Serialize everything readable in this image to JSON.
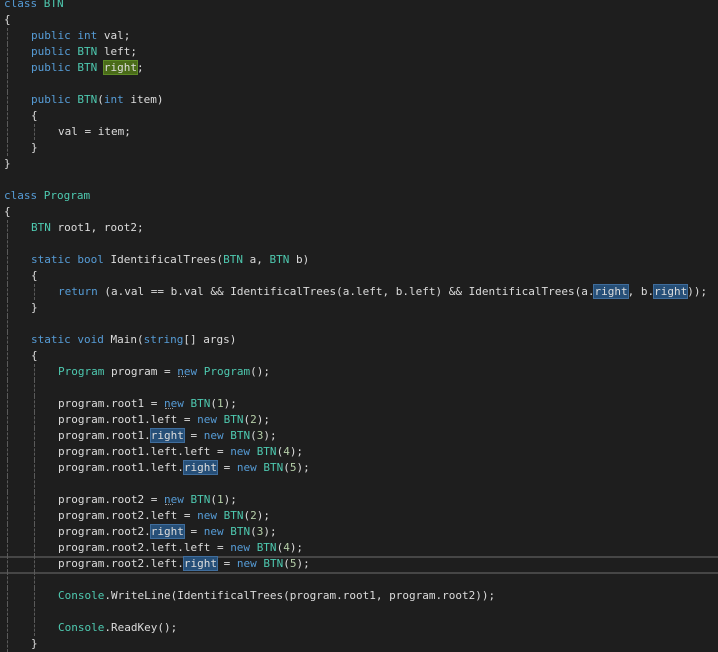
{
  "editor": {
    "language": "C#",
    "current_line": 36,
    "lines": [
      {
        "n": 1,
        "indent": 0,
        "tokens": [
          [
            "kw",
            "class"
          ],
          [
            "id",
            " "
          ],
          [
            "ty",
            "BTN"
          ]
        ]
      },
      {
        "n": 2,
        "indent": 0,
        "tokens": [
          [
            "id",
            "{"
          ]
        ]
      },
      {
        "n": 3,
        "indent": 1,
        "tokens": [
          [
            "kw",
            "public"
          ],
          [
            "id",
            " "
          ],
          [
            "kw",
            "int"
          ],
          [
            "id",
            " val;"
          ]
        ]
      },
      {
        "n": 4,
        "indent": 1,
        "tokens": [
          [
            "kw",
            "public"
          ],
          [
            "id",
            " "
          ],
          [
            "ty",
            "BTN"
          ],
          [
            "id",
            " left;"
          ]
        ]
      },
      {
        "n": 5,
        "indent": 1,
        "tokens": [
          [
            "kw",
            "public"
          ],
          [
            "id",
            " "
          ],
          [
            "ty",
            "BTN"
          ],
          [
            "id",
            " "
          ],
          [
            "hl-green",
            "right"
          ],
          [
            "id",
            ";"
          ]
        ]
      },
      {
        "n": 6,
        "indent": 0,
        "tokens": []
      },
      {
        "n": 7,
        "indent": 1,
        "tokens": [
          [
            "kw",
            "public"
          ],
          [
            "id",
            " "
          ],
          [
            "ty",
            "BTN"
          ],
          [
            "id",
            "("
          ],
          [
            "kw",
            "int"
          ],
          [
            "id",
            " item)"
          ]
        ]
      },
      {
        "n": 8,
        "indent": 1,
        "tokens": [
          [
            "id",
            "{"
          ]
        ]
      },
      {
        "n": 9,
        "indent": 2,
        "tokens": [
          [
            "id",
            "val = item;"
          ]
        ]
      },
      {
        "n": 10,
        "indent": 1,
        "tokens": [
          [
            "id",
            "}"
          ]
        ]
      },
      {
        "n": 11,
        "indent": 0,
        "tokens": [
          [
            "id",
            "}"
          ]
        ]
      },
      {
        "n": 12,
        "indent": 0,
        "tokens": []
      },
      {
        "n": 13,
        "indent": 0,
        "tokens": [
          [
            "kw",
            "class"
          ],
          [
            "id",
            " "
          ],
          [
            "ty",
            "Program"
          ]
        ]
      },
      {
        "n": 14,
        "indent": 0,
        "tokens": [
          [
            "id",
            "{"
          ]
        ]
      },
      {
        "n": 15,
        "indent": 1,
        "tokens": [
          [
            "ty",
            "BTN"
          ],
          [
            "id",
            " root1, root2;"
          ]
        ]
      },
      {
        "n": 16,
        "indent": 0,
        "tokens": []
      },
      {
        "n": 17,
        "indent": 1,
        "tokens": [
          [
            "kw",
            "static"
          ],
          [
            "id",
            " "
          ],
          [
            "kw",
            "bool"
          ],
          [
            "id",
            " IdentificalTrees("
          ],
          [
            "ty",
            "BTN"
          ],
          [
            "id",
            " a, "
          ],
          [
            "ty",
            "BTN"
          ],
          [
            "id",
            " b)"
          ]
        ]
      },
      {
        "n": 18,
        "indent": 1,
        "tokens": [
          [
            "id",
            "{"
          ]
        ]
      },
      {
        "n": 19,
        "indent": 2,
        "tokens": [
          [
            "kw",
            "return"
          ],
          [
            "id",
            " (a.val == b.val && IdentificalTrees(a.left, b.left) && IdentificalTrees(a."
          ],
          [
            "hl-blue",
            "right"
          ],
          [
            "id",
            ", b."
          ],
          [
            "hl-blue",
            "right"
          ],
          [
            "id",
            "));"
          ]
        ]
      },
      {
        "n": 20,
        "indent": 1,
        "tokens": [
          [
            "id",
            "}"
          ]
        ]
      },
      {
        "n": 21,
        "indent": 0,
        "tokens": []
      },
      {
        "n": 22,
        "indent": 1,
        "tokens": [
          [
            "kw",
            "static"
          ],
          [
            "id",
            " "
          ],
          [
            "kw",
            "void"
          ],
          [
            "id",
            " Main("
          ],
          [
            "kw",
            "string"
          ],
          [
            "id",
            "[] args)"
          ]
        ]
      },
      {
        "n": 23,
        "indent": 1,
        "tokens": [
          [
            "id",
            "{"
          ]
        ]
      },
      {
        "n": 24,
        "indent": 2,
        "tokens": [
          [
            "ty",
            "Program"
          ],
          [
            "id",
            " program = "
          ],
          [
            "kw-sugg",
            "new"
          ],
          [
            "id",
            " "
          ],
          [
            "ty",
            "Program"
          ],
          [
            "id",
            "();"
          ]
        ]
      },
      {
        "n": 25,
        "indent": 0,
        "tokens": []
      },
      {
        "n": 26,
        "indent": 2,
        "tokens": [
          [
            "id",
            "program.root1 = "
          ],
          [
            "kw-sugg",
            "new"
          ],
          [
            "id",
            " "
          ],
          [
            "ty",
            "BTN"
          ],
          [
            "id",
            "("
          ],
          [
            "num",
            "1"
          ],
          [
            "id",
            ");"
          ]
        ]
      },
      {
        "n": 27,
        "indent": 2,
        "tokens": [
          [
            "id",
            "program.root1.left = "
          ],
          [
            "kw",
            "new"
          ],
          [
            "id",
            " "
          ],
          [
            "ty",
            "BTN"
          ],
          [
            "id",
            "("
          ],
          [
            "num",
            "2"
          ],
          [
            "id",
            ");"
          ]
        ]
      },
      {
        "n": 28,
        "indent": 2,
        "tokens": [
          [
            "id",
            "program.root1."
          ],
          [
            "hl-blue",
            "right"
          ],
          [
            "id",
            " = "
          ],
          [
            "kw",
            "new"
          ],
          [
            "id",
            " "
          ],
          [
            "ty",
            "BTN"
          ],
          [
            "id",
            "("
          ],
          [
            "num",
            "3"
          ],
          [
            "id",
            ");"
          ]
        ]
      },
      {
        "n": 29,
        "indent": 2,
        "tokens": [
          [
            "id",
            "program.root1.left.left = "
          ],
          [
            "kw",
            "new"
          ],
          [
            "id",
            " "
          ],
          [
            "ty",
            "BTN"
          ],
          [
            "id",
            "("
          ],
          [
            "num",
            "4"
          ],
          [
            "id",
            ");"
          ]
        ]
      },
      {
        "n": 30,
        "indent": 2,
        "tokens": [
          [
            "id",
            "program.root1.left."
          ],
          [
            "hl-blue",
            "right"
          ],
          [
            "id",
            " = "
          ],
          [
            "kw",
            "new"
          ],
          [
            "id",
            " "
          ],
          [
            "ty",
            "BTN"
          ],
          [
            "id",
            "("
          ],
          [
            "num",
            "5"
          ],
          [
            "id",
            ");"
          ]
        ]
      },
      {
        "n": 31,
        "indent": 0,
        "tokens": []
      },
      {
        "n": 32,
        "indent": 2,
        "tokens": [
          [
            "id",
            "program.root2 = "
          ],
          [
            "kw-sugg",
            "new"
          ],
          [
            "id",
            " "
          ],
          [
            "ty",
            "BTN"
          ],
          [
            "id",
            "("
          ],
          [
            "num",
            "1"
          ],
          [
            "id",
            ");"
          ]
        ]
      },
      {
        "n": 33,
        "indent": 2,
        "tokens": [
          [
            "id",
            "program.root2.left = "
          ],
          [
            "kw",
            "new"
          ],
          [
            "id",
            " "
          ],
          [
            "ty",
            "BTN"
          ],
          [
            "id",
            "("
          ],
          [
            "num",
            "2"
          ],
          [
            "id",
            ");"
          ]
        ]
      },
      {
        "n": 34,
        "indent": 2,
        "tokens": [
          [
            "id",
            "program.root2."
          ],
          [
            "hl-blue",
            "right"
          ],
          [
            "id",
            " = "
          ],
          [
            "kw",
            "new"
          ],
          [
            "id",
            " "
          ],
          [
            "ty",
            "BTN"
          ],
          [
            "id",
            "("
          ],
          [
            "num",
            "3"
          ],
          [
            "id",
            ");"
          ]
        ]
      },
      {
        "n": 35,
        "indent": 2,
        "tokens": [
          [
            "id",
            "program.root2.left.left = "
          ],
          [
            "kw",
            "new"
          ],
          [
            "id",
            " "
          ],
          [
            "ty",
            "BTN"
          ],
          [
            "id",
            "("
          ],
          [
            "num",
            "4"
          ],
          [
            "id",
            ");"
          ]
        ]
      },
      {
        "n": 36,
        "indent": 2,
        "tokens": [
          [
            "id",
            "program.root2.left."
          ],
          [
            "hl-blue",
            "right"
          ],
          [
            "id",
            " = "
          ],
          [
            "kw",
            "new"
          ],
          [
            "id",
            " "
          ],
          [
            "ty",
            "BTN"
          ],
          [
            "id",
            "("
          ],
          [
            "num",
            "5"
          ],
          [
            "id",
            ");"
          ]
        ]
      },
      {
        "n": 37,
        "indent": 0,
        "tokens": []
      },
      {
        "n": 38,
        "indent": 2,
        "tokens": [
          [
            "ty",
            "Console"
          ],
          [
            "id",
            ".WriteLine(IdentificalTrees(program.root1, program.root2));"
          ]
        ]
      },
      {
        "n": 39,
        "indent": 0,
        "tokens": []
      },
      {
        "n": 40,
        "indent": 2,
        "tokens": [
          [
            "ty",
            "Console"
          ],
          [
            "id",
            ".ReadKey();"
          ]
        ]
      },
      {
        "n": 41,
        "indent": 1,
        "tokens": [
          [
            "id",
            "}"
          ]
        ]
      }
    ],
    "guides": {
      "level0": [
        3,
        4,
        5,
        6,
        7,
        8,
        9,
        10,
        15,
        16,
        17,
        18,
        19,
        20,
        21,
        22,
        23,
        24,
        25,
        26,
        27,
        28,
        29,
        30,
        31,
        32,
        33,
        34,
        35,
        36,
        37,
        38,
        39,
        40,
        41
      ],
      "level1": [
        9,
        19,
        24,
        25,
        26,
        27,
        28,
        29,
        30,
        31,
        32,
        33,
        34,
        35,
        36,
        37,
        38,
        39,
        40
      ]
    }
  }
}
